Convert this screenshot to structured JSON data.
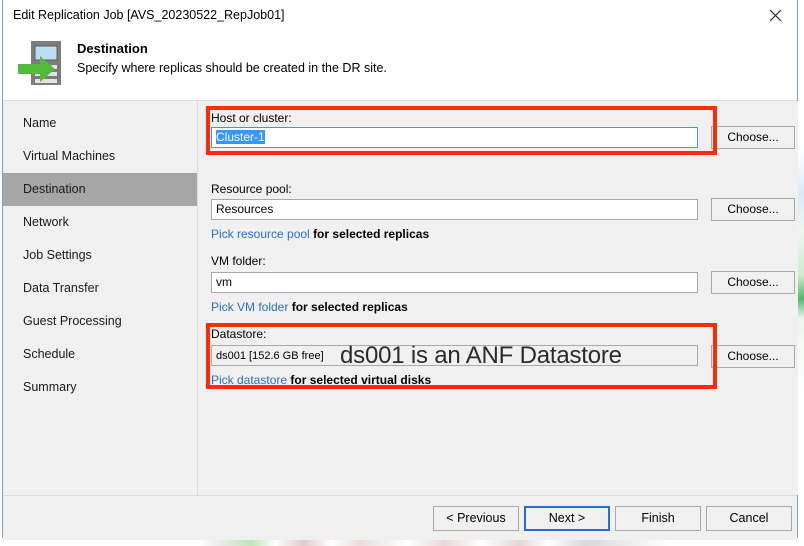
{
  "window": {
    "title": "Edit Replication Job [AVS_20230522_RepJob01]",
    "close_icon": "close-icon"
  },
  "header": {
    "icon": "server-replicate-icon",
    "title": "Destination",
    "subtitle": "Specify where replicas should be created in the DR site."
  },
  "sidebar": {
    "items": [
      {
        "label": "Name",
        "selected": false
      },
      {
        "label": "Virtual Machines",
        "selected": false
      },
      {
        "label": "Destination",
        "selected": true
      },
      {
        "label": "Network",
        "selected": false
      },
      {
        "label": "Job Settings",
        "selected": false
      },
      {
        "label": "Data Transfer",
        "selected": false
      },
      {
        "label": "Guest Processing",
        "selected": false
      },
      {
        "label": "Schedule",
        "selected": false
      },
      {
        "label": "Summary",
        "selected": false
      }
    ]
  },
  "form": {
    "host_or_cluster": {
      "label": "Host or cluster:",
      "value": "Cluster-1",
      "button": "Choose...",
      "highlighted": true
    },
    "resource_pool": {
      "label": "Resource pool:",
      "value": "Resources",
      "button": "Choose...",
      "hint_link": "Pick resource pool",
      "hint_rest": "for selected replicas"
    },
    "vm_folder": {
      "label": "VM folder:",
      "value": "vm",
      "button": "Choose...",
      "hint_link": "Pick VM folder",
      "hint_rest": "for selected replicas"
    },
    "datastore": {
      "label": "Datastore:",
      "value": "ds001 [152.6 GB free]",
      "button": "Choose...",
      "hint_link": "Pick datastore",
      "hint_rest": "for selected virtual disks",
      "highlighted": true
    }
  },
  "annotation": {
    "text": "ds001 is an ANF Datastore",
    "box_color": "#fb2d09"
  },
  "footer": {
    "previous": "< Previous",
    "next": "Next >",
    "finish": "Finish",
    "cancel": "Cancel"
  }
}
